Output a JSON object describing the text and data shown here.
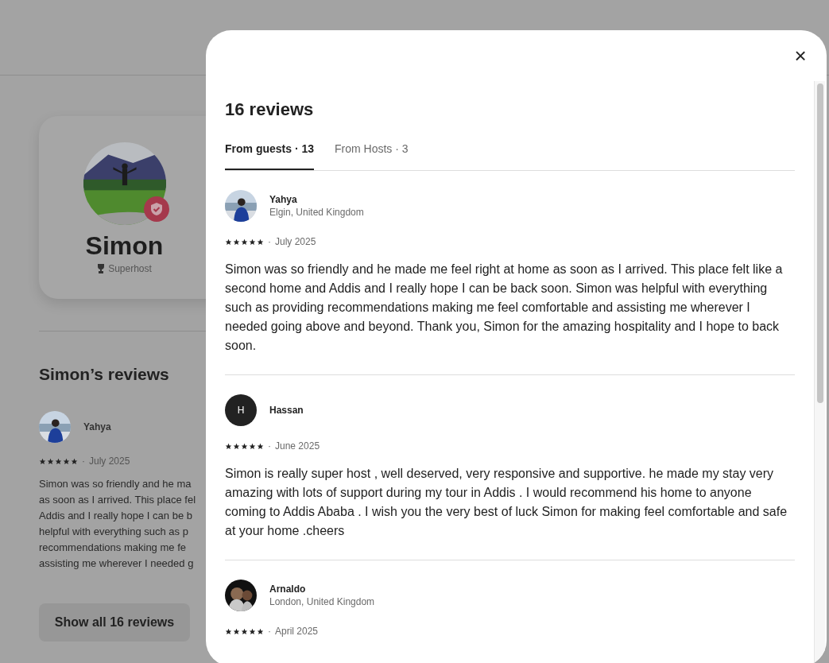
{
  "page": {
    "host": {
      "name": "Simon",
      "badge": "Superhost"
    },
    "reviews_heading": "Simon’s reviews",
    "preview": {
      "name": "Yahya",
      "stars": 5,
      "separator": "·",
      "date": "July 2025",
      "lines": [
        "Simon was so friendly and he ma",
        "as soon as I arrived. This place fel",
        "Addis and I really hope I can be b",
        "helpful with everything such as p",
        "recommendations making me fe",
        "assisting me wherever I needed g"
      ]
    },
    "show_all_button": "Show all 16 reviews"
  },
  "modal": {
    "close": "×",
    "title": "16 reviews",
    "tabs": [
      {
        "label": "From guests · 13",
        "selected": true
      },
      {
        "label": "From Hosts · 3",
        "selected": false
      }
    ],
    "reviews": [
      {
        "name": "Yahya",
        "location": "Elgin, United Kingdom",
        "stars": 5,
        "separator": "·",
        "date": "July 2025",
        "text": "Simon was so friendly and he made me feel right at home as soon as I arrived. This place felt like a second home and Addis and I really hope I can be back soon. Simon was helpful with everything such as providing recommendations making me feel comfortable and assisting me wherever I needed going above and beyond. Thank you, Simon for the amazing hospitality and I hope to back soon."
      },
      {
        "name": "Hassan",
        "avatar": {
          "kind": "initial",
          "letter": "H"
        },
        "stars": 5,
        "separator": "·",
        "date": "June 2025",
        "text": "Simon is really super host , well deserved, very responsive and supportive. he made my stay very amazing with lots of support during my tour in Addis . I would recommend his home to anyone coming to Addis Ababa . I wish you the very best of luck Simon for making feel comfortable and safe at your home .cheers"
      },
      {
        "name": "Arnaldo",
        "location": "London, United Kingdom",
        "stars": 5,
        "separator": "·",
        "date": "April 2025"
      }
    ]
  }
}
